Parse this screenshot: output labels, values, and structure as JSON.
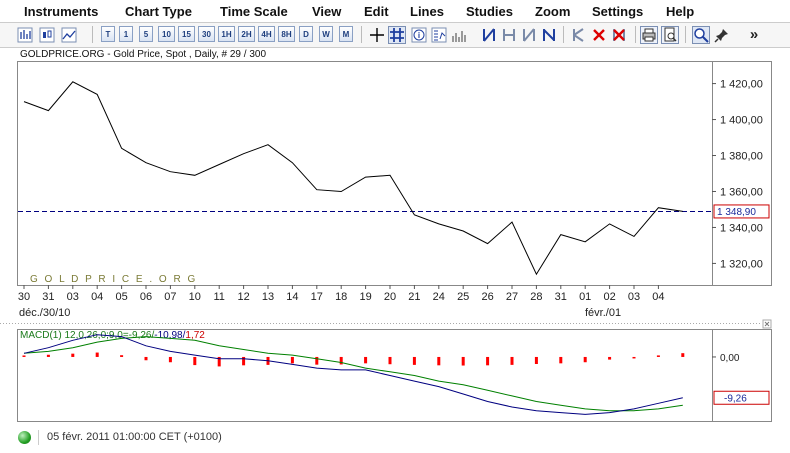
{
  "menu": [
    "Instruments",
    "Chart Type",
    "Time Scale",
    "View",
    "Edit",
    "Lines",
    "Studies",
    "Zoom",
    "Settings",
    "Help"
  ],
  "toolbar": {
    "period_buttons": [
      "T",
      "1",
      "5",
      "10",
      "15",
      "30",
      "1H",
      "2H",
      "4H",
      "8H",
      "D",
      "W",
      "M"
    ],
    "expand_label": "»"
  },
  "chart_title": "GOLDPRICE.ORG - Gold Price, Spot , Daily, # 29 / 300",
  "watermark": "G O L D P R I C E . O R G",
  "price_label": "1 348,90",
  "macd_zero_label": "0,00",
  "macd_value_label": "-9,26",
  "macd_legend": {
    "prefix": "MACD(1) 12,0,26,0;9,0=",
    "v1": "-9,26",
    "sep1": "/",
    "v2": "-10,98",
    "sep2": "/",
    "v3": "1,72"
  },
  "x_axis_secondary": [
    "déc./30/10",
    "févr./01"
  ],
  "status_text": "05 févr. 2011 01:00:00  CET (+0100)",
  "colors": {
    "price_line": "#000000",
    "current_price_line": "#000080",
    "macd_line": "#000080",
    "signal_line": "#008000",
    "histogram": "#ff0000",
    "label_box": "#cc0000"
  },
  "chart_data": [
    {
      "type": "line",
      "title": "GOLDPRICE.ORG - Gold Price, Spot , Daily, # 29 / 300",
      "categories": [
        "30",
        "31",
        "03",
        "04",
        "05",
        "06",
        "07",
        "10",
        "11",
        "12",
        "13",
        "14",
        "17",
        "18",
        "19",
        "20",
        "21",
        "24",
        "25",
        "26",
        "27",
        "28",
        "31",
        "01",
        "02",
        "03",
        "04"
      ],
      "series": [
        {
          "values": [
            1410,
            1405,
            1421,
            1414,
            1384,
            1376,
            1371,
            1369,
            1375,
            1381,
            1386,
            1376,
            1361,
            1360,
            1368,
            1369,
            1347,
            1342,
            1338,
            1331,
            1343,
            1314,
            1336,
            1332,
            1342,
            1335,
            1351,
            1348.9
          ]
        }
      ],
      "reference_line": 1348.9,
      "ylim": [
        1308,
        1432
      ],
      "yticks": [
        "1 320,00",
        "1 340,00",
        "1 360,00",
        "1 380,00",
        "1 400,00",
        "1 420,00"
      ],
      "ytick_values": [
        1320,
        1340,
        1360,
        1380,
        1400,
        1420
      ],
      "grid": false
    },
    {
      "type": "line",
      "title": "MACD(1) 12,0,26,0;9,0=-9,26/-10,98/1,72",
      "series": [
        {
          "values": [
            2,
            5,
            9,
            12,
            11,
            6,
            3,
            1,
            -1,
            -1,
            -2,
            -4,
            -6,
            -7,
            -7,
            -10,
            -13,
            -16,
            -20,
            -24,
            -27,
            -29,
            -30,
            -31,
            -30,
            -28,
            -25,
            -22
          ]
        },
        {
          "values": [
            2,
            3,
            5,
            8,
            10,
            11,
            10,
            9,
            6,
            4,
            2,
            1,
            -1,
            -3,
            -6,
            -8,
            -10,
            -13,
            -15,
            -18,
            -21,
            -24,
            -26,
            -28,
            -29,
            -29,
            -28,
            -26
          ]
        },
        {
          "values": [
            0.5,
            1,
            1.5,
            2,
            0.8,
            -1.5,
            -2.4,
            -3.7,
            -4.3,
            -3.8,
            -3.6,
            -2.9,
            -3.5,
            -3.4,
            -2.9,
            -3.3,
            -3.6,
            -3.8,
            -3.9,
            -3.8,
            -3.6,
            -3.2,
            -2.9,
            -2.4,
            -1.2,
            -0.3,
            0.7,
            1.72
          ]
        }
      ],
      "ylim": [
        -34,
        14
      ],
      "ytick": "0,00"
    }
  ]
}
